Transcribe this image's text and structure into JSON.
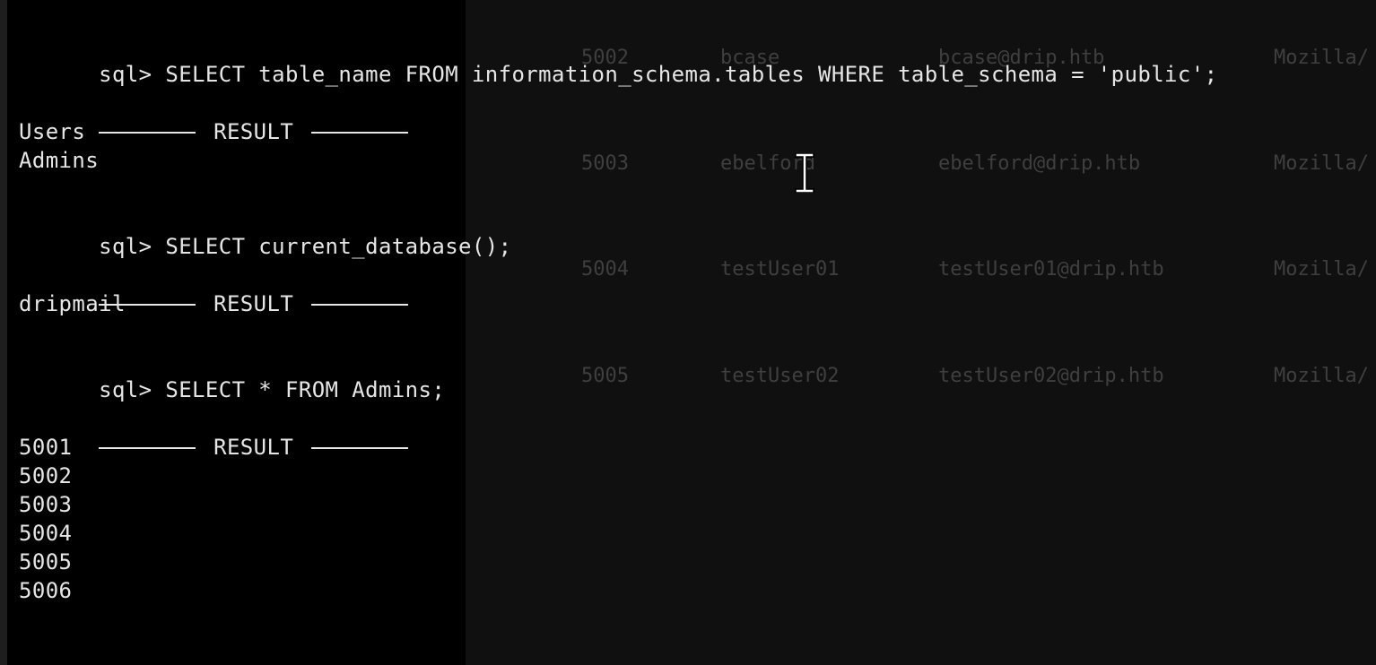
{
  "background_table": {
    "rows": [
      {
        "id": "5002",
        "username": "bcase",
        "email": "bcase@drip.htb",
        "agent": "Mozilla/"
      },
      {
        "id": "5003",
        "username": "ebelford",
        "email": "ebelford@drip.htb",
        "agent": "Mozilla/"
      },
      {
        "id": "5004",
        "username": "testUser01",
        "email": "testUser01@drip.htb",
        "agent": "Mozilla/"
      },
      {
        "id": "5005",
        "username": "testUser02",
        "email": "testUser02@drip.htb",
        "agent": "Mozilla/"
      }
    ]
  },
  "terminal": {
    "prompt": "sql> ",
    "result_label": "RESULT",
    "q1": {
      "command": "SELECT table_name FROM information_schema.tables WHERE table_schema = 'public';",
      "results": [
        "Users",
        "Admins"
      ]
    },
    "q2": {
      "command": "SELECT current_database();",
      "results": [
        "dripmail"
      ]
    },
    "q3": {
      "command": "SELECT * FROM Admins;",
      "results": [
        "5001",
        "5002",
        "5003",
        "5004",
        "5005",
        "5006"
      ]
    }
  },
  "colors": {
    "terminal_bg": "#000000",
    "terminal_text": "#e6e6e6",
    "window_bg": "#101010",
    "faded_text": "#3f3f3f"
  },
  "icons": {
    "pointer": "text-cursor-ibeam-icon"
  }
}
